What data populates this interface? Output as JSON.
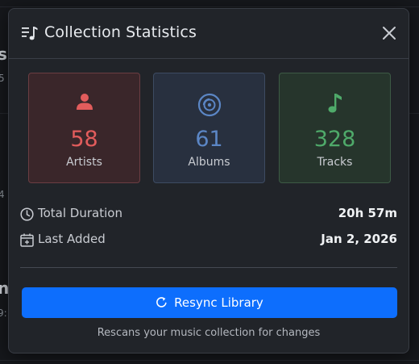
{
  "modal": {
    "title": "Collection Statistics",
    "title_icon": "music-list-icon",
    "close_icon": "close-icon"
  },
  "stats": {
    "artists": {
      "value": "58",
      "label": "Artists",
      "icon": "person-icon",
      "color": "#e25c5c"
    },
    "albums": {
      "value": "61",
      "label": "Albums",
      "icon": "disc-icon",
      "color": "#5b86c5"
    },
    "tracks": {
      "value": "328",
      "label": "Tracks",
      "icon": "music-note-icon",
      "color": "#4faa6a"
    }
  },
  "details": {
    "total_duration_label": "Total Duration",
    "total_duration_value": "20h 57m",
    "last_added_label": "Last Added",
    "last_added_value": "Jan 2, 2026"
  },
  "actions": {
    "resync_label": "Resync Library",
    "resync_hint": "Rescans your music collection for changes"
  },
  "background": {
    "fragment_s": "s",
    "fragment_n": "n",
    "small_5": "5",
    "small_4": "4",
    "small_9": "9:"
  },
  "colors": {
    "accent": "#0d6efd",
    "modal_bg": "#212429"
  }
}
